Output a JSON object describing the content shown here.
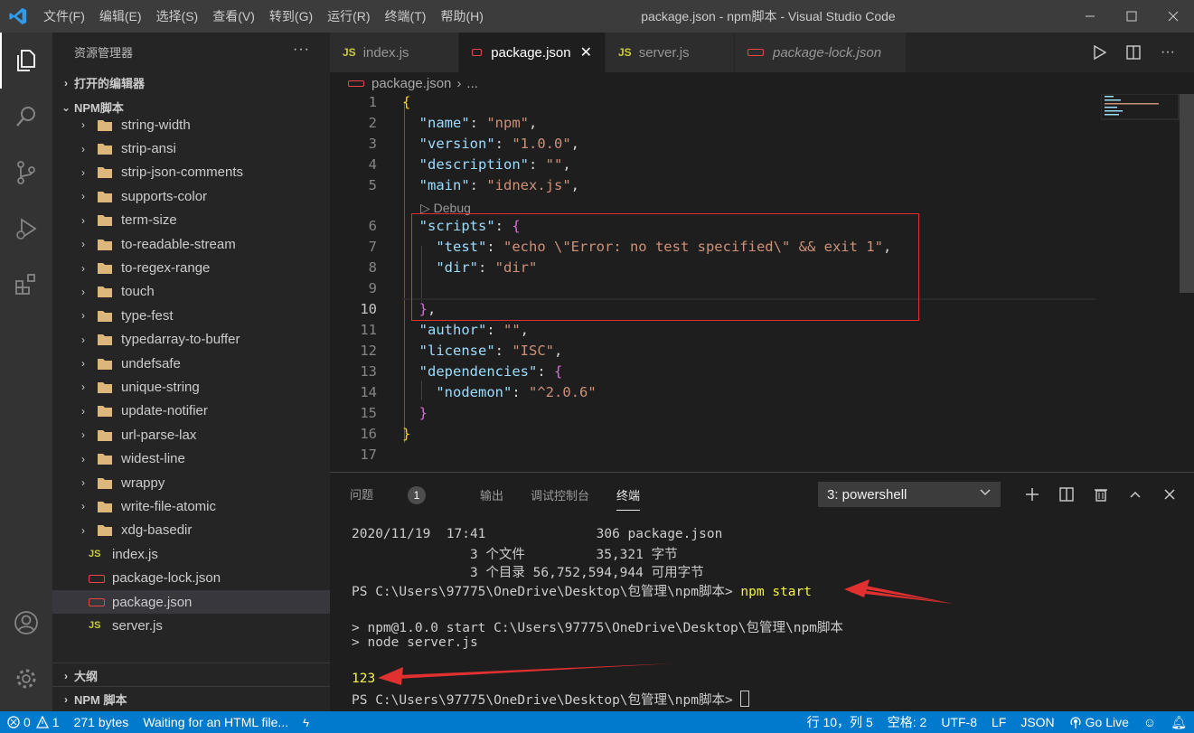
{
  "window": {
    "title": "package.json - npm脚本 - Visual Studio Code",
    "menu": [
      "文件(F)",
      "编辑(E)",
      "选择(S)",
      "查看(V)",
      "转到(G)",
      "运行(R)",
      "终端(T)",
      "帮助(H)"
    ]
  },
  "sidebar": {
    "title": "资源管理器",
    "more": "···",
    "open_editors": "打开的编辑器",
    "project": "NPM脚本",
    "folders": [
      "string-width",
      "strip-ansi",
      "strip-json-comments",
      "supports-color",
      "term-size",
      "to-readable-stream",
      "to-regex-range",
      "touch",
      "type-fest",
      "typedarray-to-buffer",
      "undefsafe",
      "unique-string",
      "update-notifier",
      "url-parse-lax",
      "widest-line",
      "wrappy",
      "write-file-atomic",
      "xdg-basedir"
    ],
    "files": [
      {
        "name": "index.js",
        "type": "js"
      },
      {
        "name": "package-lock.json",
        "type": "json"
      },
      {
        "name": "package.json",
        "type": "json",
        "selected": true
      },
      {
        "name": "server.js",
        "type": "js"
      }
    ],
    "outline": "大纲",
    "npm_scripts": "NPM 脚本"
  },
  "tabs": [
    {
      "label": "index.js",
      "type": "js"
    },
    {
      "label": "package.json",
      "type": "json",
      "active": true
    },
    {
      "label": "server.js",
      "type": "js"
    },
    {
      "label": "package-lock.json",
      "type": "json",
      "preview": true
    }
  ],
  "breadcrumb": {
    "file": "package.json",
    "sep": "›",
    "rest": "..."
  },
  "editor": {
    "line_numbers": [
      "1",
      "2",
      "3",
      "4",
      "5",
      "6",
      "7",
      "8",
      "9",
      "10",
      "11",
      "12",
      "13",
      "14",
      "15",
      "16",
      "17"
    ],
    "codelens": "Debug",
    "lines": {
      "l1": "{",
      "l2k": "\"name\"",
      "l2v": "\"npm\"",
      "l3k": "\"version\"",
      "l3v": "\"1.0.0\"",
      "l4k": "\"description\"",
      "l4v": "\"\"",
      "l5k": "\"main\"",
      "l5v": "\"idnex.js\"",
      "l6k": "\"scripts\"",
      "l6b": "{",
      "l7k": "\"test\"",
      "l7v": "\"echo \\\"Error: no test specified\\\" && exit 1\"",
      "l8k": "\"dir\"",
      "l8v": "\"dir\"",
      "l10": "}",
      "l11k": "\"author\"",
      "l11v": "\"\"",
      "l12k": "\"license\"",
      "l12v": "\"ISC\"",
      "l13k": "\"dependencies\"",
      "l13b": "{",
      "l14k": "\"nodemon\"",
      "l14v": "\"^2.0.6\"",
      "l15": "}",
      "l16": "}"
    }
  },
  "panel": {
    "tabs": {
      "problems": "问题",
      "problems_count": "1",
      "output": "输出",
      "debug_console": "调试控制台",
      "terminal": "终端"
    },
    "terminal_select": "3: powershell",
    "terminal_lines": {
      "t1": "2020/11/19  17:41              306 package.json",
      "t2": "               3 个文件         35,321 字节",
      "t3": "               3 个目录 56,752,594,944 可用字节",
      "t4_prompt": "PS C:\\Users\\97775\\OneDrive\\Desktop\\包管理\\npm脚本> ",
      "t4_cmd": "npm start",
      "t5": "> npm@1.0.0 start C:\\Users\\97775\\OneDrive\\Desktop\\包管理\\npm脚本",
      "t6": "> node server.js",
      "t7": "123",
      "t8_prompt": "PS C:\\Users\\97775\\OneDrive\\Desktop\\包管理\\npm脚本> "
    }
  },
  "statusbar": {
    "errors": "0",
    "warnings": "1",
    "size": "271 bytes",
    "message": "Waiting for an HTML file...",
    "position": "行 10，列 5",
    "spaces": "空格: 2",
    "encoding": "UTF-8",
    "eol": "LF",
    "language": "JSON",
    "golive": "Go Live"
  },
  "colors": {
    "accent": "#007acc",
    "annotation_red": "#e03030"
  }
}
